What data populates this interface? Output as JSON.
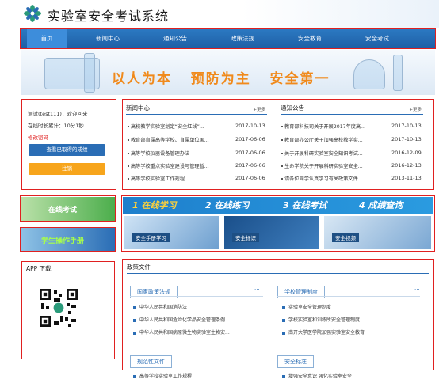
{
  "app": {
    "title": "实验室安全考试系统"
  },
  "nav": {
    "items": [
      "首页",
      "新闻中心",
      "通知公告",
      "政策法规",
      "安全教育",
      "安全考试"
    ]
  },
  "banner": {
    "slogan": "以人为本   预防为主   安全第一"
  },
  "user": {
    "greeting": "测试(test111)，欢迎回来",
    "online": "在线时长累计：10分1秒",
    "change_password": "修改密码",
    "view_scores": "查看已取得的成绩",
    "logout": "注销"
  },
  "side": {
    "online_exam": "在线考试",
    "student_manual": "学生操作手册",
    "app_download": "APP 下载"
  },
  "news": {
    "title": "新闻中心",
    "more": "+更多",
    "items": [
      {
        "text": "高校教学实验室划定“安全红线”...",
        "date": "2017-10-13"
      },
      {
        "text": "教育部直属高等学校、直属单位国...",
        "date": "2017-06-06"
      },
      {
        "text": "高等学校仪器设备管理办法",
        "date": "2017-06-06"
      },
      {
        "text": "高等学校重点实验室建设与管理暂...",
        "date": "2017-06-06"
      },
      {
        "text": "高等学校实验室工作规程",
        "date": "2017-06-06"
      }
    ]
  },
  "notice": {
    "title": "通知公告",
    "more": "+更多",
    "items": [
      {
        "text": "教育部科技司关于开展2017年度高...",
        "date": "2017-10-13"
      },
      {
        "text": "教育部办公厅关于加强高校教学实...",
        "date": "2017-10-13"
      },
      {
        "text": "关于开展科研实验室安全知识考试...",
        "date": "2016-12-09"
      },
      {
        "text": "生命学院关于开展科研实验室安全...",
        "date": "2016-12-13"
      },
      {
        "text": "请各位同学认真学习有关政策文件...",
        "date": "2013-11-13"
      }
    ]
  },
  "steps": {
    "items": [
      "1 在线学习",
      "2 在线练习",
      "3 在线考试",
      "4 成绩查询"
    ]
  },
  "thumbs": {
    "items": [
      "安全手册学习",
      "安全标识",
      "安全视频"
    ]
  },
  "policy": {
    "title": "政策文件",
    "national": {
      "label": "国家政策法规",
      "more": "···",
      "items": [
        "中华人民共和国消防法",
        "中华人民共和国危险化学品安全管理条例",
        "中华人民共和国病原微生物实验室生物安..."
      ]
    },
    "school": {
      "label": "学校管理制度",
      "more": "···",
      "items": [
        "实验室安全管理制度",
        "学校实验室和训练所安全管理制度",
        "南开大学医学院加强实验室安全教育"
      ]
    },
    "norms": {
      "label": "规范性文件",
      "more": "···",
      "items": [
        "高等学校实验室工作规程"
      ]
    },
    "standards": {
      "label": "安全标准",
      "more": "···",
      "items": [
        "增强安全意识 强化实验室安全"
      ]
    }
  },
  "colors": {
    "accent": "#2a6db5",
    "nav": "#1f5fa5",
    "highlight": "#e02020",
    "orange": "#f08a1c"
  }
}
